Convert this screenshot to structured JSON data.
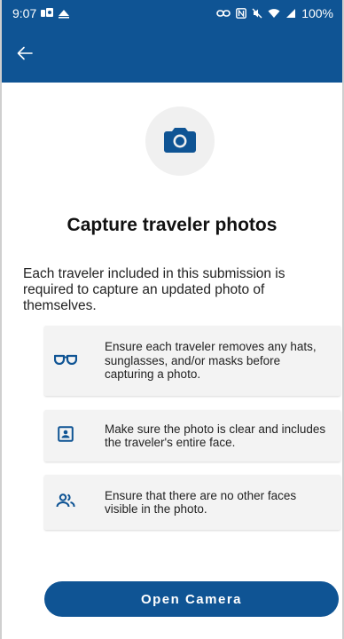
{
  "status_bar": {
    "time": "9:07",
    "battery": "100%"
  },
  "header": {
    "back_icon": "arrow-left-icon",
    "color": "#0f5494"
  },
  "hero": {
    "icon": "camera-icon"
  },
  "title": "Capture traveler photos",
  "intro": "Each traveler included in this submission is required to capture an updated photo of themselves.",
  "tips": [
    {
      "icon": "glasses-icon",
      "text": "Ensure each traveler removes any hats, sunglasses, and/or masks before capturing a photo."
    },
    {
      "icon": "portrait-icon",
      "text": "Make sure the photo is clear and includes the traveler's entire face."
    },
    {
      "icon": "people-icon",
      "text": "Ensure that there are no other faces visible in the photo."
    }
  ],
  "primary_button": {
    "label": "Open Camera"
  }
}
